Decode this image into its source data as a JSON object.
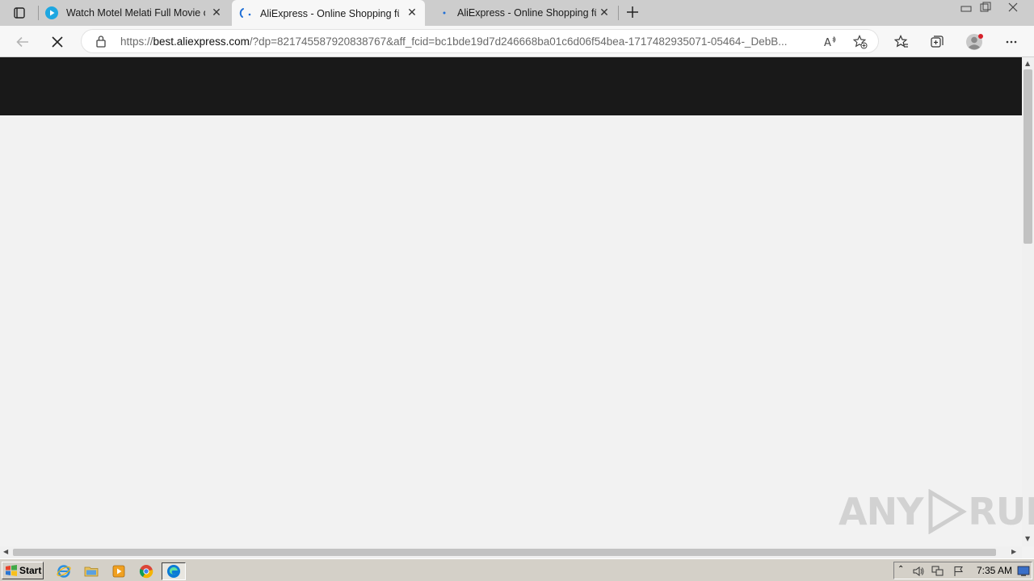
{
  "browser": {
    "tabs": [
      {
        "title": "Watch Motel Melati Full Movie o",
        "icon": "play-circle-icon",
        "active": false
      },
      {
        "title": "AliExpress - Online Shopping für",
        "icon": "loading-spinner-icon",
        "active": true
      },
      {
        "title": "AliExpress - Online Shopping für",
        "icon": "loading-dot-icon",
        "active": false
      }
    ],
    "address": {
      "scheme": "https://",
      "host": "best.aliexpress.com",
      "rest": "/?dp=821745587920838767&aff_fcid=bc1bde19d7d246668ba01c6d06f54bea-1717482935071-05464-_DebB..."
    }
  },
  "watermark": {
    "left": "ANY",
    "right": "RUN"
  },
  "taskbar": {
    "start_label": "Start",
    "clock": "7:35 AM"
  },
  "colors": {
    "page_header": "#191919",
    "page_bg": "#f2f2f2",
    "tabbar": "#cdcdcd",
    "accent": "#0078d4"
  }
}
